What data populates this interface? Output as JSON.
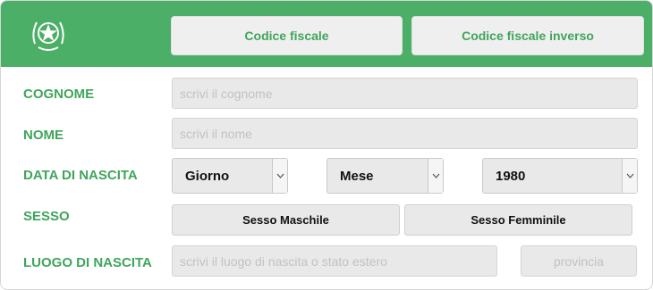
{
  "header": {
    "emblem_icon": "italian-emblem-icon",
    "buttons": {
      "codice_fiscale": "Codice fiscale",
      "codice_fiscale_inverso": "Codice fiscale inverso"
    }
  },
  "form": {
    "cognome": {
      "label": "COGNOME",
      "placeholder": "scrivi il cognome"
    },
    "nome": {
      "label": "NOME",
      "placeholder": "scrivi il nome"
    },
    "data_nascita": {
      "label": "DATA DI NASCITA",
      "giorno": "Giorno",
      "mese": "Mese",
      "anno": "1980"
    },
    "sesso": {
      "label": "SESSO",
      "maschile": "Sesso Maschile",
      "femminile": "Sesso Femminile"
    },
    "luogo_nascita": {
      "label": "LUOGO DI NASCITA",
      "placeholder": "scrivi il luogo di nascita o stato estero",
      "provincia": "provincia"
    }
  },
  "colors": {
    "accent": "#4caf67",
    "label": "#3fa55b",
    "field_bg": "#e9e9e9"
  }
}
